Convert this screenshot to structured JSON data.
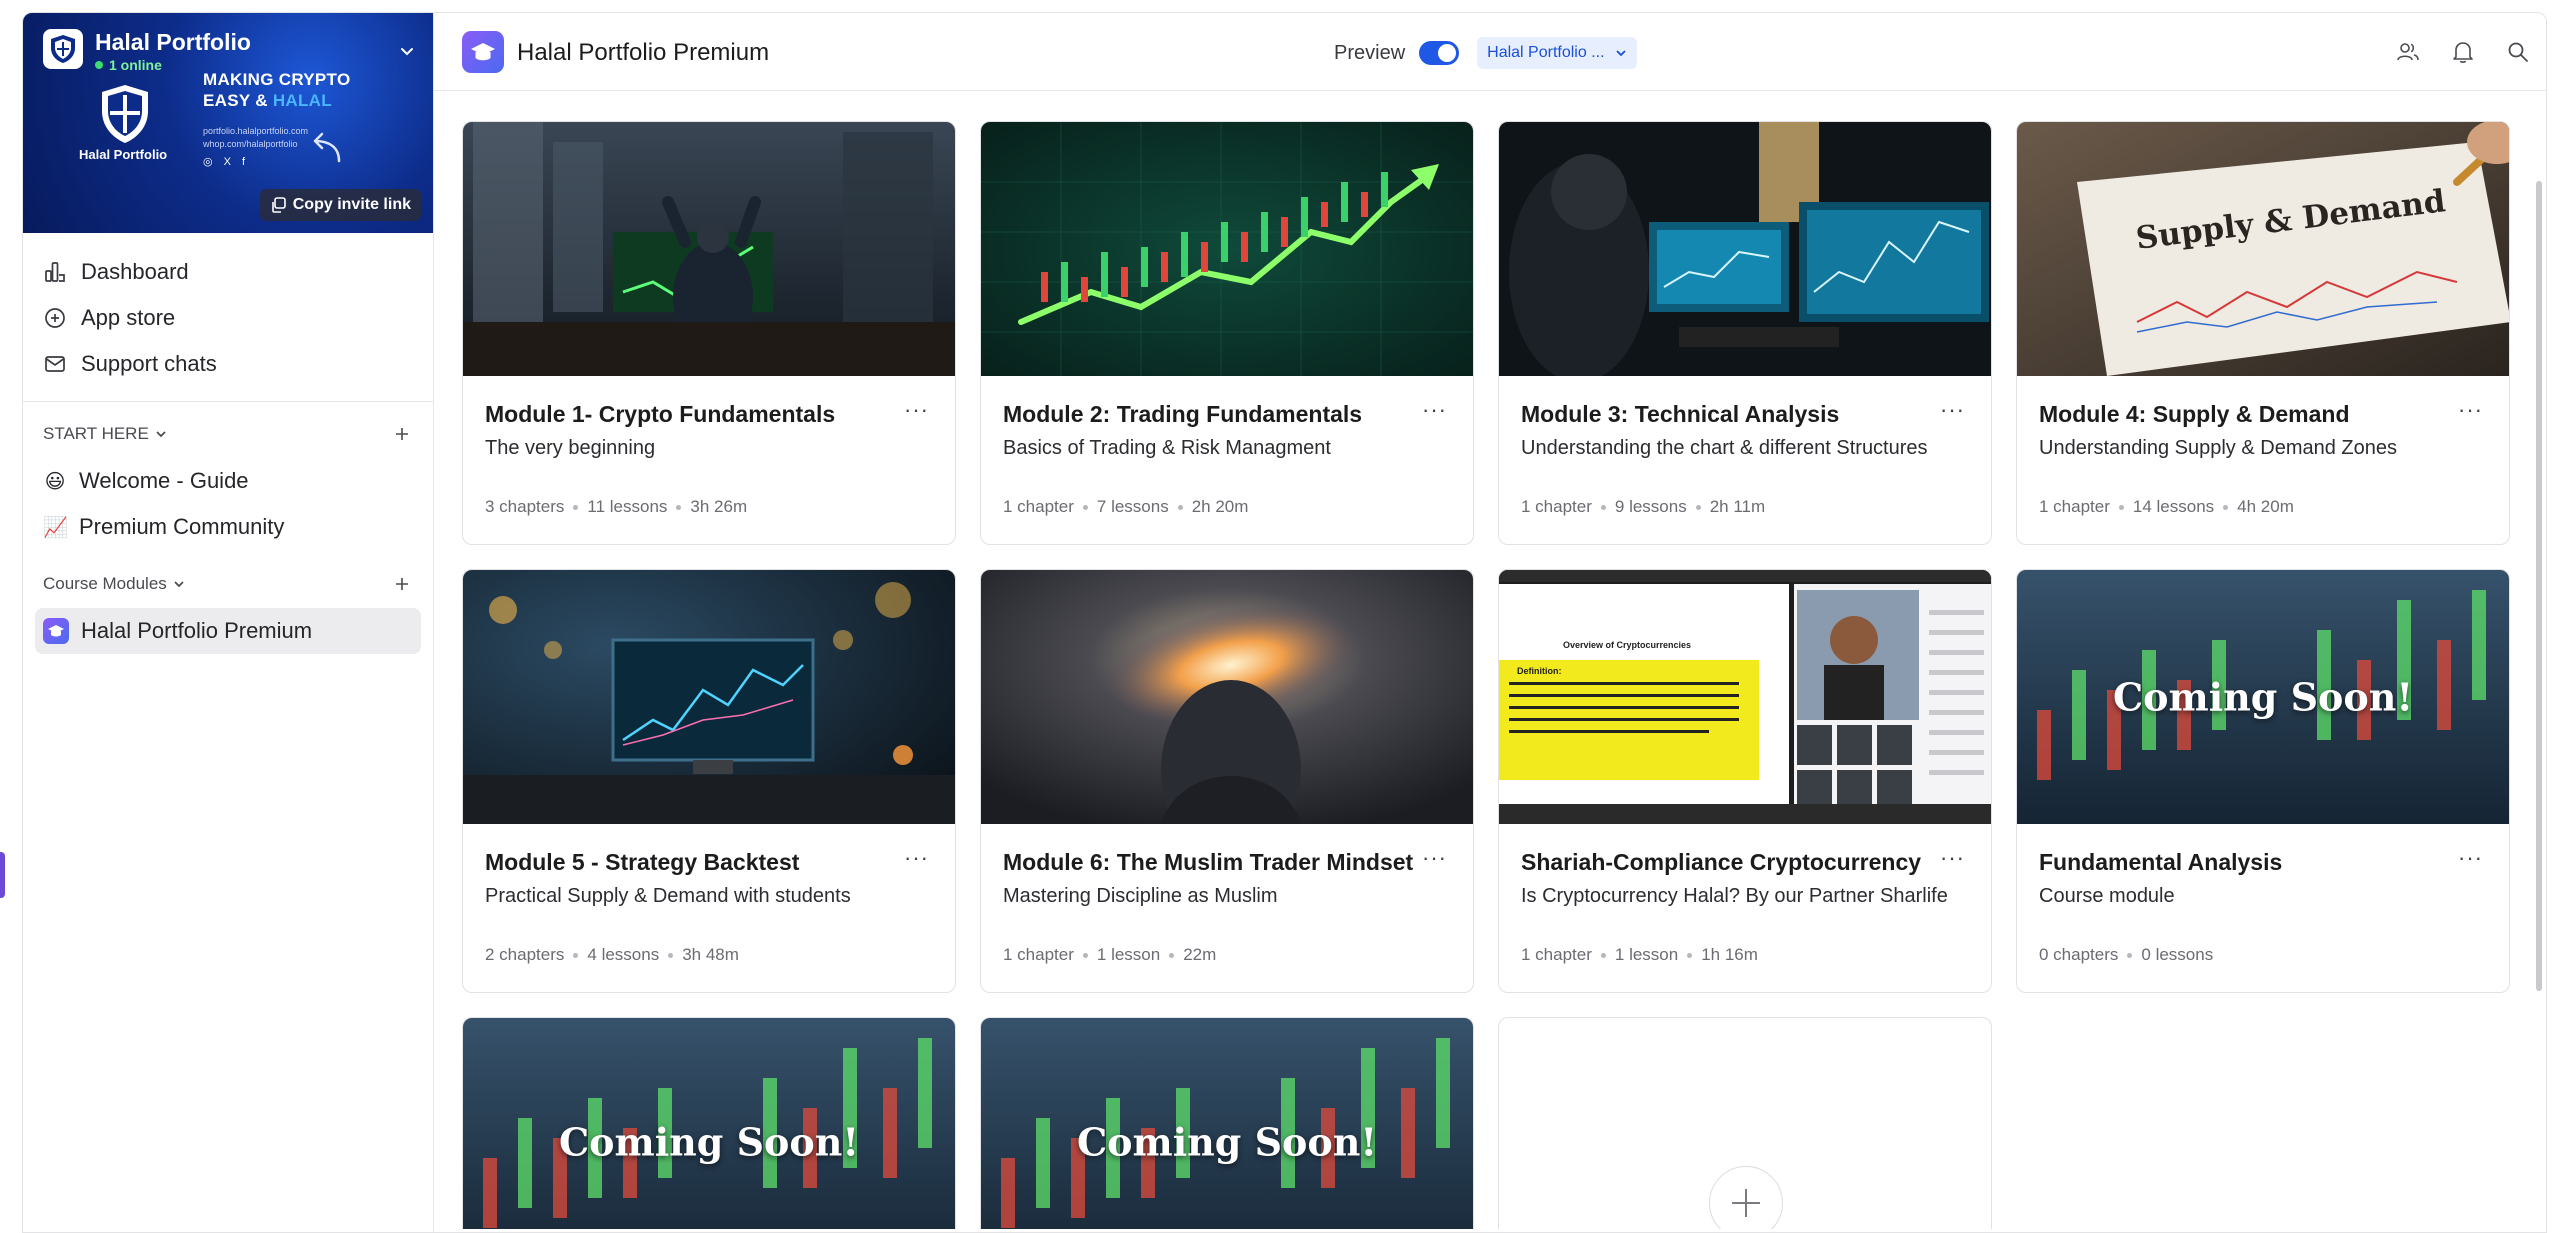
{
  "workspace": {
    "name": "Halal Portfolio",
    "online": "1 online",
    "banner_tagline_1": "MAKING CRYPTO",
    "banner_tagline_2": "EASY & ",
    "banner_tagline_3": "HALAL",
    "banner_brand": "Halal Portfolio",
    "banner_line_1": "portfolio.halalportfolio.com",
    "banner_line_2": "whop.com/halalportfolio",
    "banner_social": "◎ X f",
    "copy_invite_label": "Copy invite link"
  },
  "sidebar": {
    "nav": [
      {
        "label": "Dashboard",
        "icon": "chart-bars-icon"
      },
      {
        "label": "App store",
        "icon": "plus-circle-icon"
      },
      {
        "label": "Support chats",
        "icon": "mail-icon"
      }
    ],
    "sections": [
      {
        "title": "START HERE",
        "items": [
          {
            "label": "Welcome - Guide",
            "emoji": "😃"
          },
          {
            "label": "Premium Community",
            "emoji": "📈"
          }
        ]
      },
      {
        "title": "Course Modules",
        "items": [
          {
            "label": "Halal Portfolio Premium",
            "active": true
          }
        ]
      }
    ]
  },
  "header": {
    "title": "Halal Portfolio Premium",
    "preview_label": "Preview",
    "preview_on": true,
    "view_select": "Halal Portfolio ..."
  },
  "cards": [
    {
      "title": "Module 1- Crypto Fundamentals",
      "subtitle": "The very beginning",
      "chapters": "3 chapters",
      "lessons": "11 lessons",
      "duration": "3h 26m"
    },
    {
      "title": "Module 2: Trading Fundamentals",
      "subtitle": "Basics of Trading & Risk Managment",
      "chapters": "1 chapter",
      "lessons": "7 lessons",
      "duration": "2h 20m"
    },
    {
      "title": "Module 3: Technical Analysis",
      "subtitle": "Understanding the chart & different Structures",
      "chapters": "1 chapter",
      "lessons": "9 lessons",
      "duration": "2h 11m"
    },
    {
      "title": "Module 4: Supply & Demand",
      "subtitle": "Understanding Supply & Demand Zones",
      "chapters": "1 chapter",
      "lessons": "14 lessons",
      "duration": "4h 20m",
      "image_text": "Supply & Demand"
    },
    {
      "title": "Module 5 - Strategy Backtest",
      "subtitle": "Practical Supply & Demand with students",
      "chapters": "2 chapters",
      "lessons": "4 lessons",
      "duration": "3h 48m"
    },
    {
      "title": "Module 6: The Muslim Trader Mindset",
      "subtitle": "Mastering Discipline as Muslim",
      "chapters": "1 chapter",
      "lessons": "1 lesson",
      "duration": "22m"
    },
    {
      "title": "Shariah-Compliance Cryptocurrency",
      "subtitle": "Is Cryptocurrency Halal? By our Partner Sharlife",
      "chapters": "1 chapter",
      "lessons": "1 lesson",
      "duration": "1h 16m",
      "image_heading": "Overview of Cryptocurrencies",
      "image_definition": "Definition:"
    },
    {
      "title": "Fundamental Analysis",
      "subtitle": "Course module",
      "chapters": "0 chapters",
      "lessons": "0 lessons",
      "image_text": "Coming Soon!"
    },
    {
      "image_text": "Coming Soon!"
    },
    {
      "image_text": "Coming Soon!"
    }
  ],
  "colors": {
    "accent": "#1f57e6",
    "brand_purple": "#6b4bd6",
    "banner_blue": "#0d2c8a"
  }
}
